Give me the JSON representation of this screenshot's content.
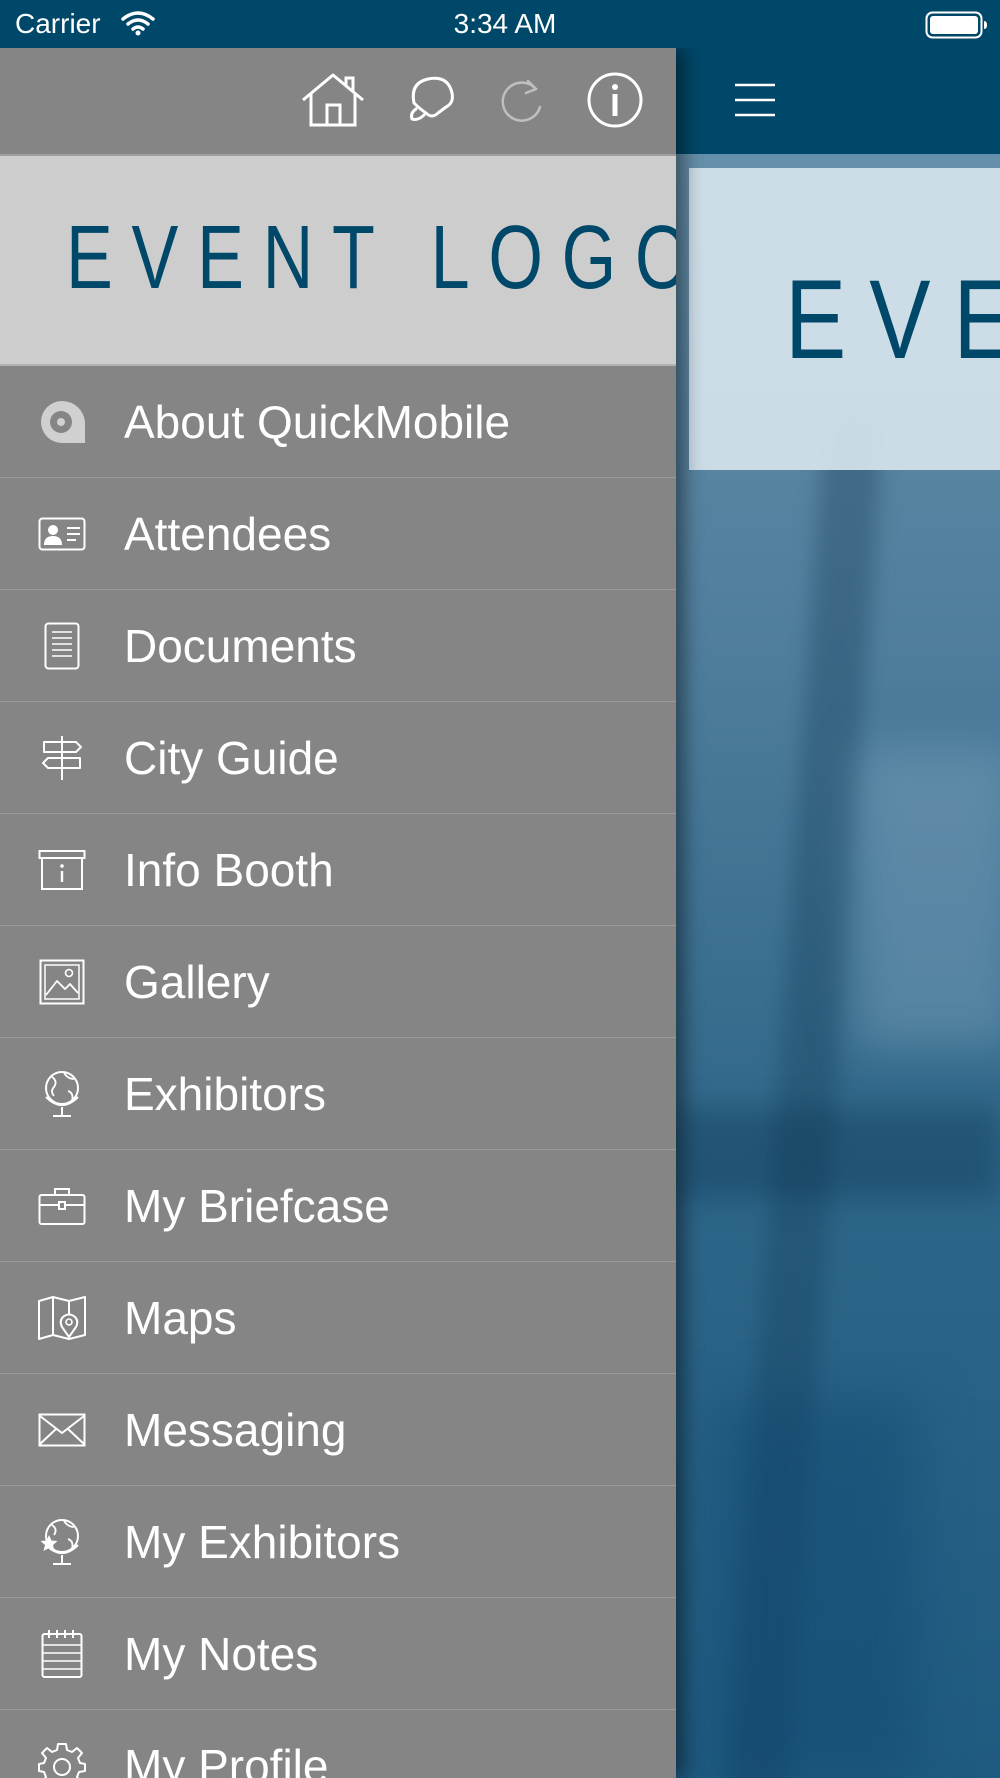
{
  "status_bar": {
    "carrier": "Carrier",
    "time": "3:34 AM",
    "wifi_icon": "wifi-icon",
    "battery_icon": "battery-icon"
  },
  "drawer": {
    "toolbar": [
      {
        "id": "home",
        "icon": "home-icon"
      },
      {
        "id": "notifications",
        "icon": "bell-icon"
      },
      {
        "id": "refresh",
        "icon": "refresh-icon"
      },
      {
        "id": "info",
        "icon": "info-icon"
      }
    ],
    "logo_text": "EVENT LOGO",
    "items": [
      {
        "label": "About QuickMobile",
        "icon": "quickmobile-icon"
      },
      {
        "label": "Attendees",
        "icon": "id-card-icon"
      },
      {
        "label": "Documents",
        "icon": "document-icon"
      },
      {
        "label": "City Guide",
        "icon": "signpost-icon"
      },
      {
        "label": "Info Booth",
        "icon": "info-booth-icon"
      },
      {
        "label": "Gallery",
        "icon": "image-icon"
      },
      {
        "label": "Exhibitors",
        "icon": "globe-icon"
      },
      {
        "label": "My Briefcase",
        "icon": "briefcase-icon"
      },
      {
        "label": "Maps",
        "icon": "map-icon"
      },
      {
        "label": "Messaging",
        "icon": "envelope-icon"
      },
      {
        "label": "My Exhibitors",
        "icon": "globe-star-icon"
      },
      {
        "label": "My Notes",
        "icon": "notepad-icon"
      },
      {
        "label": "My Profile",
        "icon": "gear-icon"
      }
    ]
  },
  "main": {
    "menu_icon": "hamburger-menu-icon",
    "logo_text": "EVE"
  },
  "colors": {
    "brand": "#004869",
    "drawer_bg": "#858585",
    "logo_bg": "#cdcdcd"
  }
}
